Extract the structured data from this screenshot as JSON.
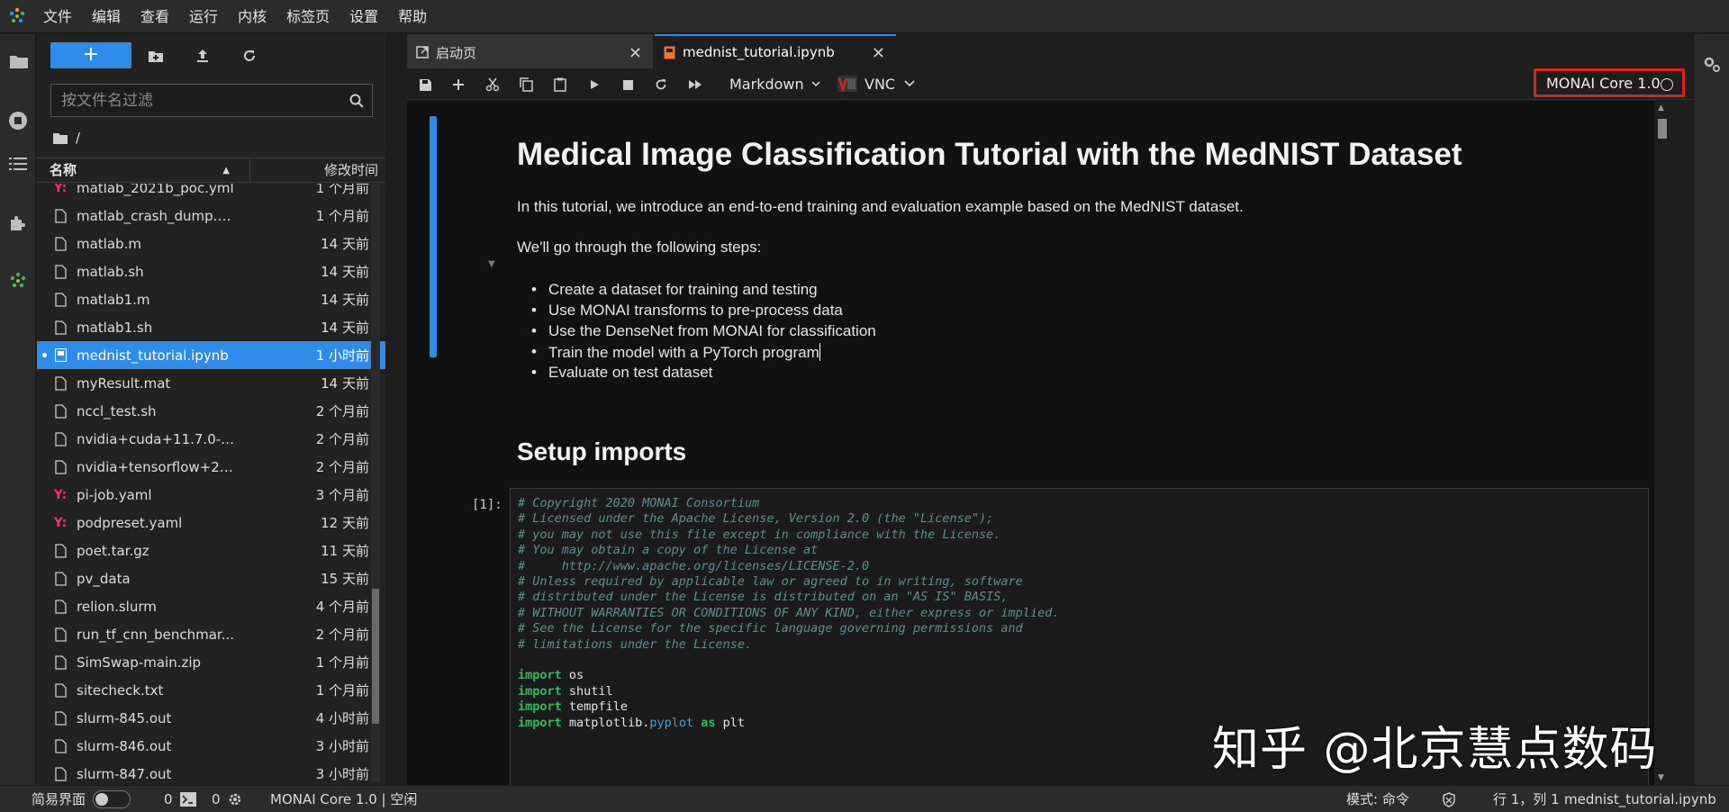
{
  "menubar": {
    "items": [
      "文件",
      "编辑",
      "查看",
      "运行",
      "内核",
      "标签页",
      "设置",
      "帮助"
    ]
  },
  "activity_icons": [
    "folder-icon",
    "running-icon",
    "toc-icon",
    "extensions-icon",
    "monai-icon"
  ],
  "filebrowser": {
    "new_label": "+",
    "filter_placeholder": "按文件名过滤",
    "breadcrumb": "/",
    "col_name": "名称",
    "col_modified": "修改时间",
    "files": [
      {
        "name": "matlab_2021b_poc.yml",
        "modified": "1 个月前",
        "icon": "yaml-icon",
        "selected": false
      },
      {
        "name": "matlab_crash_dump.1...",
        "modified": "1 个月前",
        "icon": "file-icon",
        "selected": false
      },
      {
        "name": "matlab.m",
        "modified": "14 天前",
        "icon": "file-icon",
        "selected": false
      },
      {
        "name": "matlab.sh",
        "modified": "14 天前",
        "icon": "file-icon",
        "selected": false
      },
      {
        "name": "matlab1.m",
        "modified": "14 天前",
        "icon": "file-icon",
        "selected": false
      },
      {
        "name": "matlab1.sh",
        "modified": "14 天前",
        "icon": "file-icon",
        "selected": false
      },
      {
        "name": "mednist_tutorial.ipynb",
        "modified": "1 小时前",
        "icon": "notebook-icon",
        "selected": true
      },
      {
        "name": "myResult.mat",
        "modified": "14 天前",
        "icon": "file-icon",
        "selected": false
      },
      {
        "name": "nccl_test.sh",
        "modified": "2 个月前",
        "icon": "file-icon",
        "selected": false
      },
      {
        "name": "nvidia+cuda+11.7.0-b...",
        "modified": "2 个月前",
        "icon": "file-icon",
        "selected": false
      },
      {
        "name": "nvidia+tensorflow+22...",
        "modified": "2 个月前",
        "icon": "file-icon",
        "selected": false
      },
      {
        "name": "pi-job.yaml",
        "modified": "3 个月前",
        "icon": "yaml-icon",
        "selected": false
      },
      {
        "name": "podpreset.yaml",
        "modified": "12 天前",
        "icon": "yaml-icon",
        "selected": false
      },
      {
        "name": "poet.tar.gz",
        "modified": "11 天前",
        "icon": "file-icon",
        "selected": false
      },
      {
        "name": "pv_data",
        "modified": "15 天前",
        "icon": "file-icon",
        "selected": false
      },
      {
        "name": "relion.slurm",
        "modified": "4 个月前",
        "icon": "file-icon",
        "selected": false
      },
      {
        "name": "run_tf_cnn_benchmar...",
        "modified": "2 个月前",
        "icon": "file-icon",
        "selected": false
      },
      {
        "name": "SimSwap-main.zip",
        "modified": "1 个月前",
        "icon": "file-icon",
        "selected": false
      },
      {
        "name": "sitecheck.txt",
        "modified": "1 个月前",
        "icon": "file-icon",
        "selected": false
      },
      {
        "name": "slurm-845.out",
        "modified": "4 小时前",
        "icon": "file-icon",
        "selected": false
      },
      {
        "name": "slurm-846.out",
        "modified": "3 小时前",
        "icon": "file-icon",
        "selected": false
      },
      {
        "name": "slurm-847.out",
        "modified": "3 小时前",
        "icon": "file-icon",
        "selected": false
      }
    ]
  },
  "tabs": [
    {
      "label": "启动页",
      "icon": "launcher-icon",
      "active": false
    },
    {
      "label": "mednist_tutorial.ipynb",
      "icon": "notebook-icon",
      "active": true
    }
  ],
  "toolbar": {
    "cell_type": "Markdown",
    "vnc_label": "VNC",
    "kernel_name": "MONAI Core 1.0"
  },
  "notebook": {
    "title": "Medical Image Classification Tutorial with the MedNIST Dataset",
    "intro": "In this tutorial, we introduce an end-to-end training and evaluation example based on the MedNIST dataset.",
    "steps_intro": "We'll go through the following steps:",
    "steps": [
      "Create a dataset for training and testing",
      "Use MONAI transforms to pre-process data",
      "Use the DenseNet from MONAI for classification",
      "Train the model with a PyTorch program",
      "Evaluate on test dataset"
    ],
    "setup_heading": "Setup imports",
    "prompt": "[1]:",
    "code_comments": [
      "# Copyright 2020 MONAI Consortium",
      "# Licensed under the Apache License, Version 2.0 (the \"License\");",
      "# you may not use this file except in compliance with the License.",
      "# You may obtain a copy of the License at",
      "#     http://www.apache.org/licenses/LICENSE-2.0",
      "# Unless required by applicable law or agreed to in writing, software",
      "# distributed under the License is distributed on an \"AS IS\" BASIS,",
      "# WITHOUT WARRANTIES OR CONDITIONS OF ANY KIND, either express or implied.",
      "# See the License for the specific language governing permissions and",
      "# limitations under the License."
    ],
    "code_imports": [
      {
        "kw": "import",
        "name": "os"
      },
      {
        "kw": "import",
        "name": "shutil"
      },
      {
        "kw": "import",
        "name": "tempfile"
      }
    ],
    "code_last": {
      "kw": "import",
      "mod1": "matplotlib.",
      "mod2": "pyplot",
      "as": "as",
      "alias": "plt"
    }
  },
  "watermark": "知乎 @北京慧点数码",
  "statusbar": {
    "simple_mode": "简易界面",
    "terminals_count": "0",
    "kernels_count": "0",
    "kernel_status": "MONAI Core 1.0 | 空闲",
    "mode": "模式: 命令",
    "cursor_pos": "行 1，列 1",
    "filename": "mednist_tutorial.ipynb"
  },
  "colors": {
    "accent": "#2f8bea",
    "kernel_highlight": "#e02020",
    "keyword": "#2fbf5a",
    "comment": "#5f8f8f",
    "module": "#3aa0e0"
  }
}
